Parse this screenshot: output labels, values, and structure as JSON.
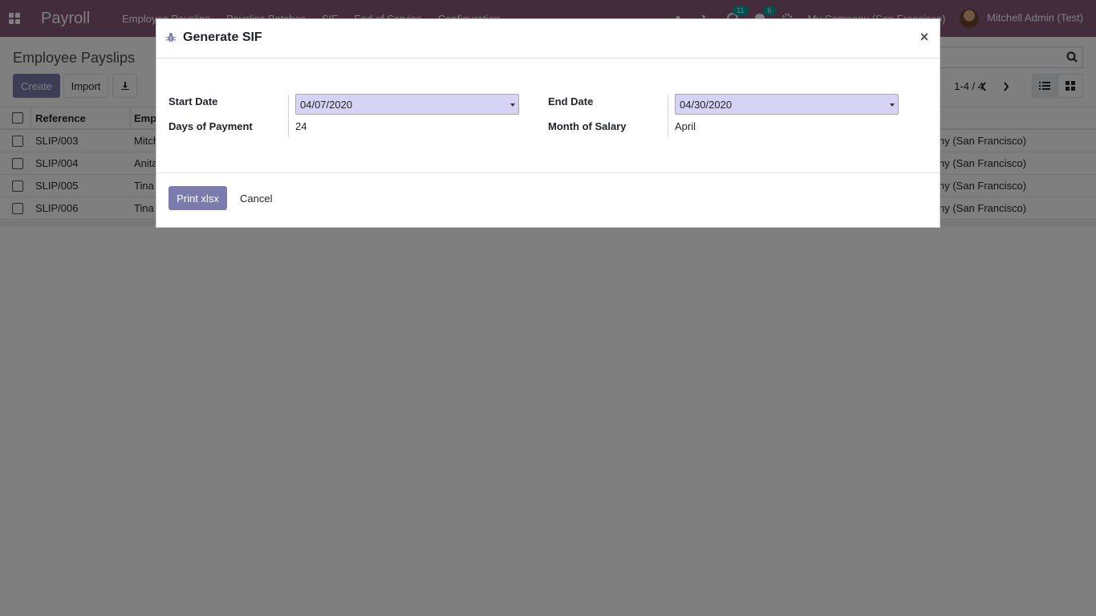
{
  "navbar": {
    "app_title": "Payroll",
    "menu": [
      "Employee Payslips",
      "Payslips Batches",
      "SIF",
      "End of Service",
      "Configuration"
    ],
    "systray": {
      "activity_count": "11",
      "messages_count": "6",
      "company": "My Company (San Francisco)",
      "user": "Mitchell Admin (Test)"
    }
  },
  "control_panel": {
    "breadcrumb": "Employee Payslips",
    "create_label": "Create",
    "import_label": "Import",
    "pager": "1-4 / 4"
  },
  "list": {
    "headers": {
      "reference": "Reference",
      "employee": "Emp",
      "company": ""
    },
    "rows": [
      {
        "reference": "SLIP/003",
        "employee": "Mitch",
        "company": "ny (San Francisco)"
      },
      {
        "reference": "SLIP/004",
        "employee": "Anita",
        "company": "ny (San Francisco)"
      },
      {
        "reference": "SLIP/005",
        "employee": "Tina",
        "company": "ny (San Francisco)"
      },
      {
        "reference": "SLIP/006",
        "employee": "Tina",
        "company": "ny (San Francisco)"
      }
    ]
  },
  "modal": {
    "title": "Generate SIF",
    "close_symbol": "×",
    "fields": {
      "start_date_label": "Start Date",
      "start_date_value": "04/07/2020",
      "end_date_label": "End Date",
      "end_date_value": "04/30/2020",
      "days_label": "Days of Payment",
      "days_value": "24",
      "month_label": "Month of Salary",
      "month_value": "April"
    },
    "print_label": "Print xlsx",
    "cancel_label": "Cancel"
  },
  "colors": {
    "navbar": "#875A7B",
    "primary_button": "#7C7BAD",
    "date_input_bg": "#d6d3f5"
  }
}
